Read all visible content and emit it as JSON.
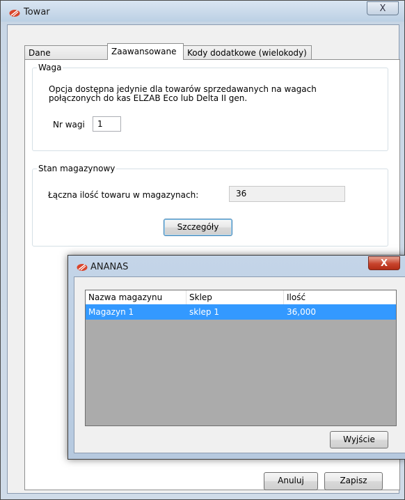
{
  "window": {
    "title": "Towar",
    "close_symbol": "X"
  },
  "tabs": [
    {
      "label": "Dane podstawowe"
    },
    {
      "label": "Zaawansowane"
    },
    {
      "label": "Kody dodatkowe (wielokody)"
    }
  ],
  "waga": {
    "legend": "Waga",
    "info_line1": "Opcja dostępna jedynie dla towarów sprzedawanych na wagach",
    "info_line2": "połączonych do kas ELZAB Eco lub Delta II gen.",
    "nr_wagi_label": "Nr wagi",
    "nr_wagi_value": "1"
  },
  "stan": {
    "legend": "Stan magazynowy",
    "total_label": "Łączna ilość towaru w magazynach:",
    "total_value": "36",
    "details_button": "Szczegóły"
  },
  "footer": {
    "cancel_button": "Anuluj",
    "save_button": "Zapisz"
  },
  "dialog": {
    "title": "ANANAS",
    "close_symbol": "X",
    "columns": [
      "Nazwa magazynu",
      "Sklep",
      "Ilość"
    ],
    "rows": [
      {
        "magazyn": "Magazyn 1",
        "sklep": "sklep 1",
        "ilosc": "36,000"
      }
    ],
    "exit_button": "Wyjście"
  },
  "colors": {
    "selection": "#3399ff",
    "grid_background": "#ababab",
    "dialog_close": "#c7432c"
  }
}
